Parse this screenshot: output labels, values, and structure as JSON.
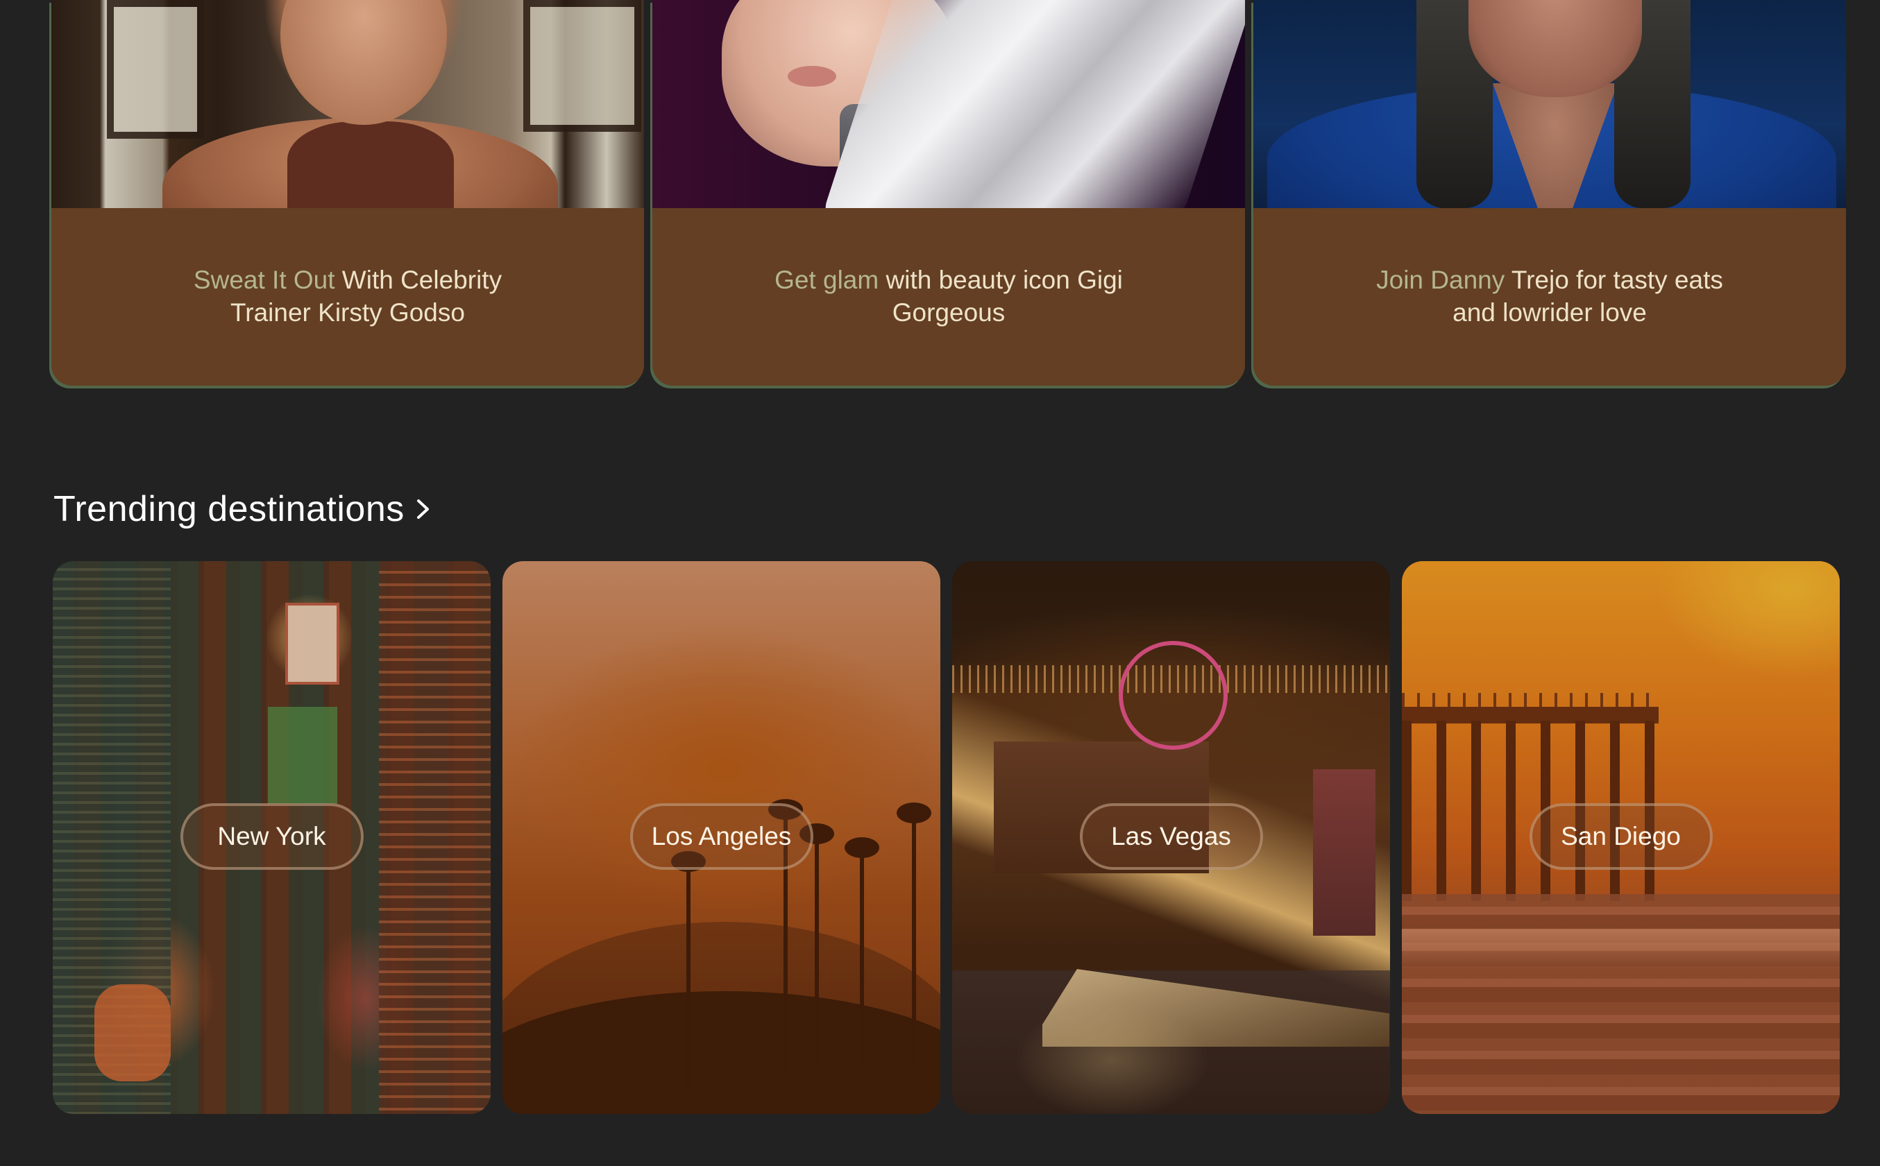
{
  "experiences": [
    {
      "title_highlight": "Sweat It Out",
      "title_rest": " With Celebrity Trainer Kirsty Godso",
      "photo": "woman-in-cafe-photo"
    },
    {
      "title_highlight": "Get glam",
      "title_rest": " with beauty icon Gigi Gorgeous",
      "photo": "silver-hair-woman-photo"
    },
    {
      "title_highlight": "Join Danny",
      "title_rest": " Trejo for tasty eats and lowrider love",
      "photo": "danny-trejo-photo"
    }
  ],
  "trending": {
    "heading": "Trending destinations",
    "chevron_icon": "chevron-right-icon",
    "destinations": [
      {
        "name": "New York"
      },
      {
        "name": "Los Angeles"
      },
      {
        "name": "Las Vegas"
      },
      {
        "name": "San Diego"
      }
    ]
  },
  "colors": {
    "background": "#222222",
    "card_brown": "#643f23",
    "title_cream": "#efe3c9",
    "title_highlight": "#b5b68e",
    "heading_white": "#ffffff"
  }
}
